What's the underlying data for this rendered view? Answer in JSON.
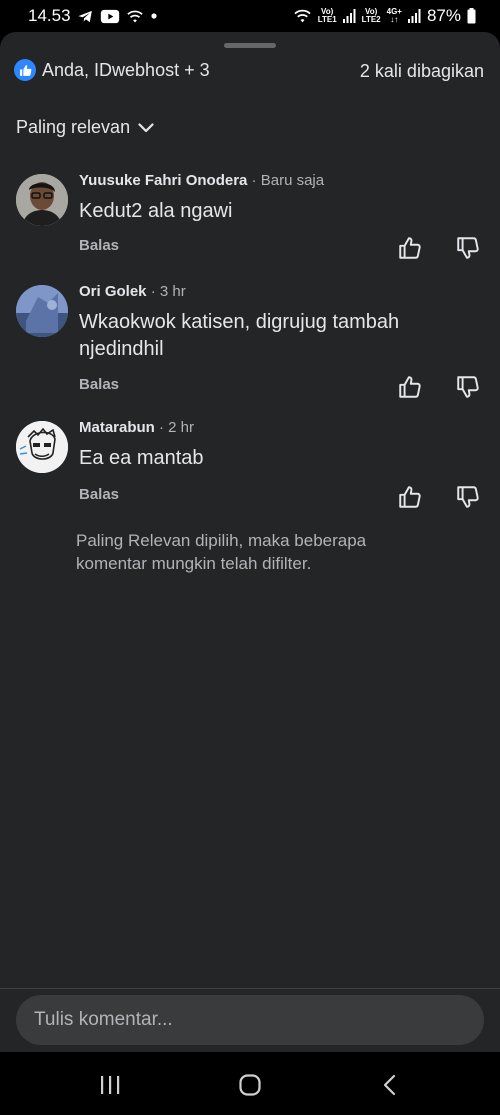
{
  "status_bar": {
    "time": "14.53",
    "sim1_top": "Vo)",
    "sim1_bottom": "LTE1",
    "sim2_top": "Vo)",
    "sim2_bottom": "LTE2",
    "network": "4G+",
    "battery": "87%"
  },
  "header": {
    "reactors": "Anda, IDwebhost + 3",
    "shares": "2 kali dibagikan"
  },
  "sort": {
    "label": "Paling relevan"
  },
  "comments": [
    {
      "author": "Yuusuke Fahri Onodera",
      "time": " · Baru saja",
      "text": "Kedut2 ala ngawi",
      "reply": "Balas"
    },
    {
      "author": "Ori Golek",
      "time": " · 3 hr",
      "text": "Wkaokwok katisen, digrujug tambah njedindhil",
      "reply": "Balas"
    },
    {
      "author": "Matarabun",
      "time": " · 2 hr",
      "text": "Ea ea mantab",
      "reply": "Balas"
    }
  ],
  "filter_note": "Paling Relevan dipilih, maka beberapa komentar mungkin telah difilter.",
  "composer": {
    "placeholder": "Tulis komentar..."
  },
  "icons": {
    "like": "thumbs-up-icon",
    "dislike": "thumbs-down-icon",
    "sort": "chevron-down-icon",
    "nav": [
      "recent-apps-icon",
      "home-icon",
      "back-icon"
    ]
  },
  "colors": {
    "accent": "#2d88ff",
    "sheet": "#242526",
    "input": "#3a3b3c"
  }
}
